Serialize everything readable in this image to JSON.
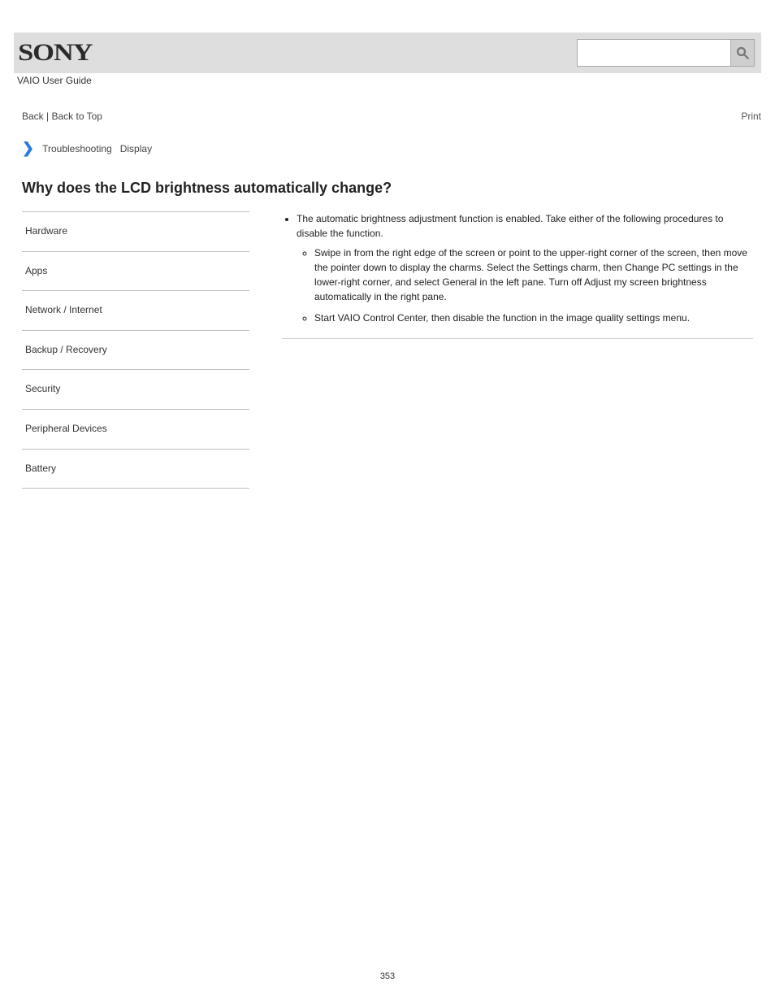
{
  "header": {
    "logo_text": "SONY",
    "product": "VAIO User Guide",
    "search_placeholder": ""
  },
  "topnav": {
    "back_label": "Back",
    "top_label": "Back to Top",
    "print_label": "Print"
  },
  "breadcrumb": {
    "crumb1": "Troubleshooting",
    "crumb2": "Display"
  },
  "section_title": "Why does the LCD brightness automatically change?",
  "sidebar": {
    "items": [
      {
        "label": "Hardware"
      },
      {
        "label": "Apps"
      },
      {
        "label": "Network / Internet"
      },
      {
        "label": "Backup / Recovery"
      },
      {
        "label": "Security"
      },
      {
        "label": "Peripheral Devices"
      },
      {
        "label": "Battery"
      }
    ]
  },
  "content": {
    "bullet": "The automatic brightness adjustment function is enabled. Take either of the following procedures to disable the function.",
    "inner": [
      "Swipe in from the right edge of the screen or point to the upper-right corner of the screen, then move the pointer down to display the charms. Select the Settings charm, then Change PC settings in the lower-right corner, and select General in the left pane. Turn off Adjust my screen brightness automatically in the right pane.",
      "Start VAIO Control Center, then disable the function in the image quality settings menu."
    ]
  },
  "page_number": "353"
}
